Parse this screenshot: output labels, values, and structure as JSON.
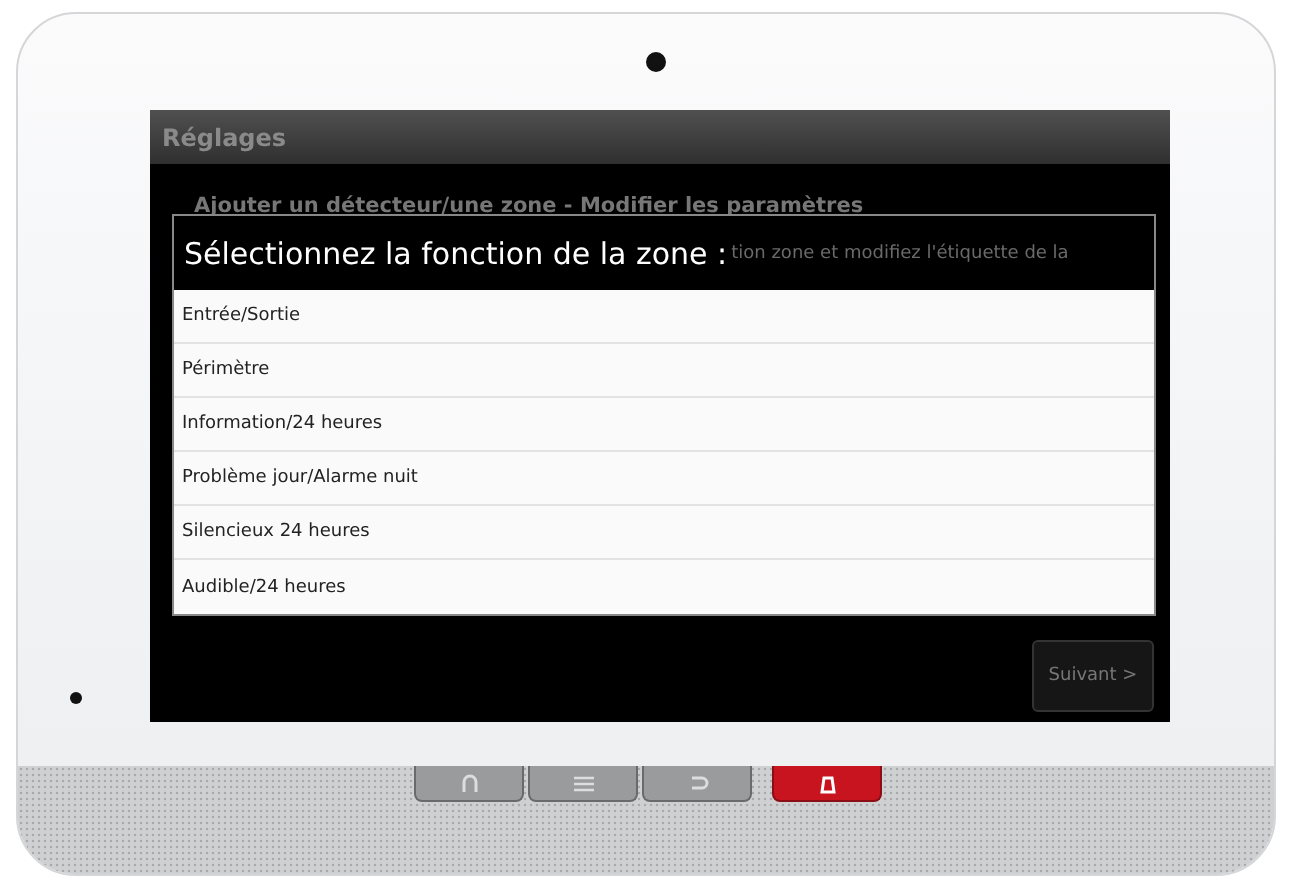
{
  "screen": {
    "title": "Réglages",
    "subheading": "Ajouter un détecteur/une zone - Modifier les paramètres",
    "covered_text": "tion zone et modifiez l'étiquette de la"
  },
  "dialog": {
    "title": "Sélectionnez la fonction de la zone :",
    "options": [
      {
        "label": "Entrée/Sortie"
      },
      {
        "label": "Périmètre"
      },
      {
        "label": "Information/24 heures"
      },
      {
        "label": "Problème jour/Alarme nuit"
      },
      {
        "label": "Silencieux 24 heures"
      },
      {
        "label": "Audible/24 heures"
      }
    ]
  },
  "next_button": "Suivant >"
}
